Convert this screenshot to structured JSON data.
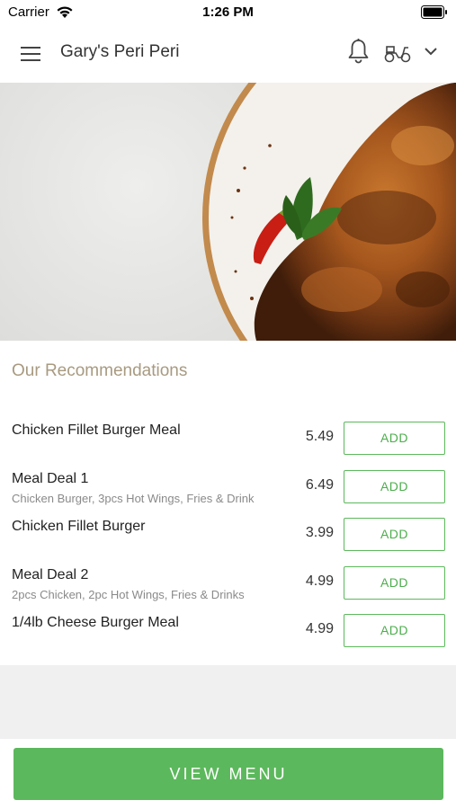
{
  "status_bar": {
    "carrier": "Carrier",
    "time": "1:26 PM"
  },
  "header": {
    "title": "Gary's Peri Peri",
    "icons": [
      "menu-icon",
      "bell-icon",
      "scooter-icon",
      "chevron-down-icon"
    ]
  },
  "recommendations": {
    "title": "Our Recommendations",
    "items": [
      {
        "name": "Chicken Fillet Burger Meal",
        "description": "",
        "price": "5.49",
        "button": "ADD"
      },
      {
        "name": "Meal Deal 1",
        "description": "Chicken Burger, 3pcs Hot Wings, Fries & Drink",
        "price": "6.49",
        "button": "ADD"
      },
      {
        "name": "Chicken Fillet Burger",
        "description": "",
        "price": "3.99",
        "button": "ADD"
      },
      {
        "name": "Meal Deal 2",
        "description": "2pcs Chicken, 2pc Hot Wings, Fries & Drinks",
        "price": "4.99",
        "button": "ADD"
      },
      {
        "name": "1/4lb Cheese Burger Meal",
        "description": "",
        "price": "4.99",
        "button": "ADD"
      }
    ]
  },
  "footer": {
    "view_menu_label": "VIEW MENU"
  },
  "colors": {
    "accent_green": "#5cb85c",
    "section_title": "#a89a80"
  }
}
